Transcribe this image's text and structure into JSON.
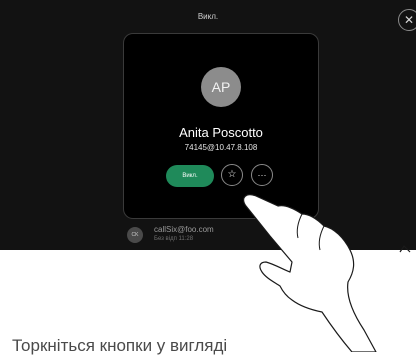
{
  "screen": {
    "title": "Викл.",
    "close_glyph": "✕"
  },
  "recent": {
    "avatar_initials": "CK",
    "name": "callSix@foo.com",
    "subtitle": "Без відп 11:28"
  },
  "contact": {
    "initials": "AP",
    "name": "Anita Poscotto",
    "address": "74145@10.47.8.108",
    "call_label": "Викл.",
    "favorite_glyph": "☆",
    "more_glyph": "···"
  },
  "caption": "Торкніться кнопки у вигляді",
  "icons": {
    "close": "close-icon",
    "favorite": "star-icon",
    "more": "more-icon",
    "hand": "hand-pointer-icon"
  },
  "colors": {
    "screen_bg": "#121212",
    "call_button": "#1f8a5a",
    "avatar": "#8c8c8c"
  }
}
